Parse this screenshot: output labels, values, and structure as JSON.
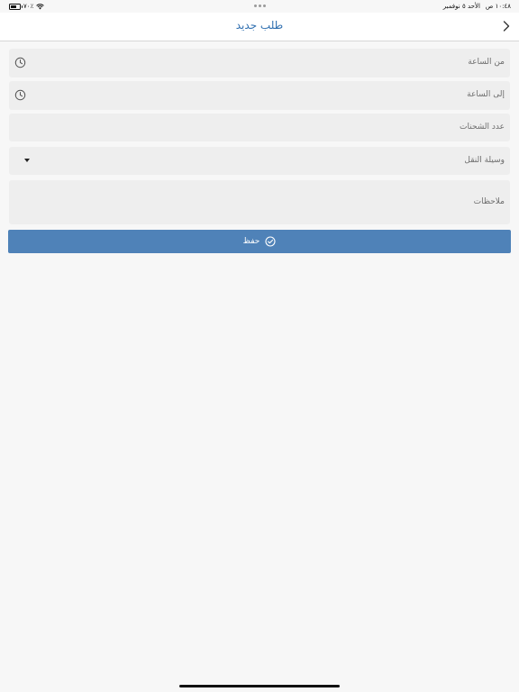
{
  "status_bar": {
    "time": "١٠:٤٨ ص",
    "date": "الأحد ٥ نوفمبر",
    "battery_percent_label": "٧٠٪",
    "battery_level": 0.7
  },
  "nav": {
    "title": "طلب جديد"
  },
  "form": {
    "from_time": {
      "label": "من الساعة",
      "value": ""
    },
    "to_time": {
      "label": "إلى الساعة",
      "value": ""
    },
    "shipments_count": {
      "label": "عدد الشحنات",
      "value": ""
    },
    "transport": {
      "label": "وسيلة النقل",
      "selected": ""
    },
    "notes": {
      "label": "ملاحظات",
      "value": ""
    }
  },
  "actions": {
    "save_label": "حفظ"
  },
  "colors": {
    "accent": "#2f6fb0",
    "button": "#4f82b8",
    "field_bg": "#eeeeee",
    "page_bg": "#f7f7f7"
  }
}
